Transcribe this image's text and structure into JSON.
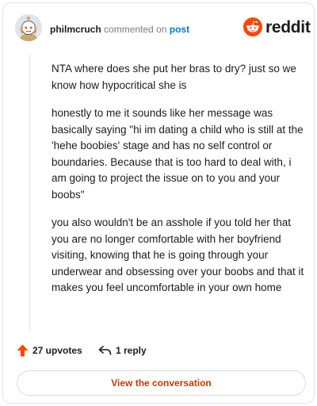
{
  "header": {
    "username": "philmcruch",
    "action_text": "commented on",
    "target_link": "post",
    "brand": "reddit"
  },
  "comment": {
    "paragraphs": [
      "NTA where does she put her bras to dry? just so we know how hypocritical she is",
      "honestly to me it sounds like her message was basically saying \"hi im dating a child who is still at the 'hehe boobies' stage and has no self control or boundaries. Because that is too hard to deal with, i am going to project the issue on to you and your boobs\"",
      "you also wouldn't be an asshole if you told her that you are no longer comfortable with her boyfriend visiting, knowing that he is going through your underwear and obsessing over your boobs and that it makes you feel uncomfortable in your own home"
    ]
  },
  "footer": {
    "upvotes_label": "27 upvotes",
    "replies_label": "1 reply",
    "cta_label": "View the conversation"
  },
  "colors": {
    "brand_orange": "#ff4500",
    "link_blue": "#0079d3",
    "cta_text": "#c13a00"
  },
  "icons": {
    "avatar": "snoo-avatar",
    "brand": "reddit-snoo-icon",
    "upvote": "upvote-arrow-icon",
    "reply": "reply-arrow-icon"
  }
}
